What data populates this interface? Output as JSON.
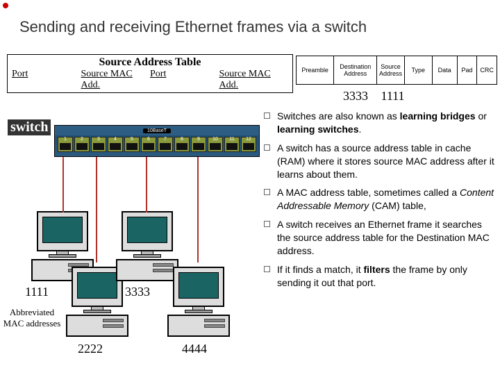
{
  "title": "Sending and receiving Ethernet frames via a switch",
  "sa": {
    "title": "Source Address Table",
    "h1": "Port",
    "h2": "Source MAC Add.",
    "h3": "Port",
    "h4": "Source MAC Add."
  },
  "frame": [
    "Preamble",
    "Destination Address",
    "Source Address",
    "Type",
    "Data",
    "Pad",
    "CRC"
  ],
  "da": "3333",
  "sa_val": "1111",
  "switch_label": "switch",
  "switch_media": "10BaseT",
  "ports": [
    "1",
    "2",
    "3",
    "4",
    "5",
    "6",
    "7",
    "8",
    "9",
    "10",
    "11",
    "12"
  ],
  "mac": {
    "m1": "1111",
    "m2": "2222",
    "m3": "3333",
    "m4": "4444"
  },
  "abbr": "Abbreviated MAC addresses",
  "bul": [
    {
      "pre": "Switches are also known as ",
      "b1": "learning bridges",
      "mid": " or ",
      "b2": "learning switches",
      "post": "."
    },
    {
      "t": "A switch has a source address table in cache (RAM) where it stores source MAC address after it learns about them."
    },
    {
      "pre": "A MAC address table, sometimes called a ",
      "i": "Content Addressable Memory",
      "post": " (CAM) table,"
    },
    {
      "t": "A switch receives an Ethernet frame it searches the source address table for the Destination MAC address."
    },
    {
      "pre": "If it finds a match, it ",
      "b1": "filters",
      "post": " the frame by only sending it out that port."
    }
  ]
}
